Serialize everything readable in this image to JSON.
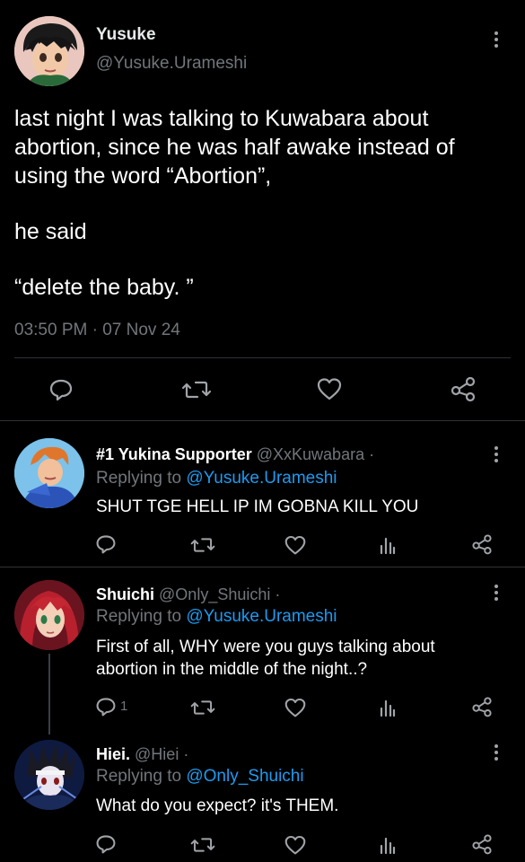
{
  "main_tweet": {
    "name": "Yusuke",
    "handle": "@Yusuke.Urameshi",
    "body_line1": "last night I was talking to Kuwabara about",
    "body_line2": "abortion, since he was half awake instead of",
    "body_line3": "using the word “Abortion”,",
    "body_line4": "he said",
    "body_line5": "“delete the baby. ”",
    "timestamp": "03:50 PM · 07 Nov 24",
    "actions": [
      "comment-icon",
      "retweet-icon",
      "heart-icon",
      "share-icon"
    ]
  },
  "replies": [
    {
      "name": "#1 Yukina Supporter",
      "handle": "@XxKuwabara ·",
      "replying_prefix": "Replying to ",
      "replying_to": "@Yusuke.Urameshi",
      "text": "SHUT TGE HELL IP IM GOBNA KILL YOU",
      "reply_count": ""
    },
    {
      "name": "Shuichi",
      "handle": "@Only_Shuichi ·",
      "replying_prefix": "Replying to ",
      "replying_to": "@Yusuke.Urameshi",
      "text_line1": "First of all, WHY were you guys talking about",
      "text_line2": "abortion in the middle of the night..?",
      "reply_count": "1"
    },
    {
      "name": "Hiei.",
      "handle": "@Hiei ·",
      "replying_prefix": "Replying to ",
      "replying_to": "@Only_Shuichi",
      "text": "What do you expect? it's THEM.",
      "reply_count": ""
    }
  ],
  "colors": {
    "background": "#000000",
    "muted": "#71767b",
    "link": "#1d9bf0",
    "text": "#e7e9ea"
  }
}
